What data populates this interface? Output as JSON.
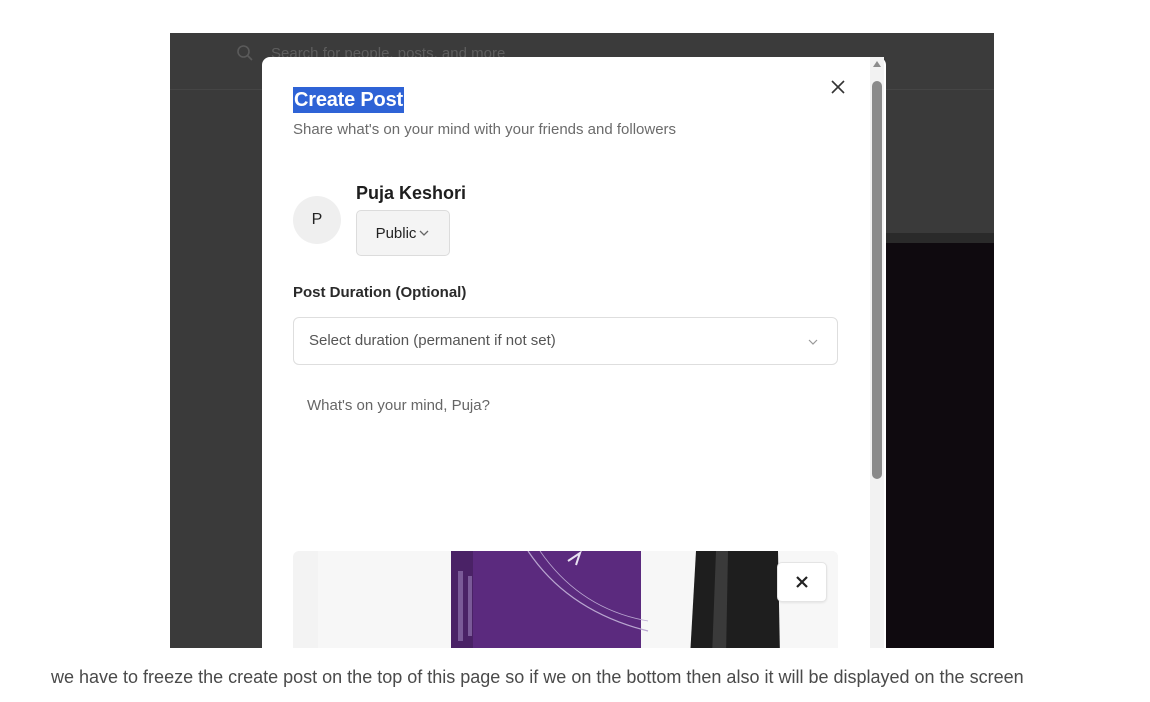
{
  "background": {
    "search_placeholder": "Search for people, posts, and more"
  },
  "modal": {
    "title": "Create Post",
    "subtitle": "Share what's on your mind with your friends and followers",
    "user": {
      "avatar_letter": "P",
      "name": "Puja Keshori",
      "privacy": "Public"
    },
    "duration": {
      "label": "Post Duration (Optional)",
      "placeholder": "Select duration (permanent if not set)"
    },
    "post_placeholder": "What's on your mind, Puja?",
    "icons": {
      "close": "close-icon",
      "remove_image": "close-icon",
      "privacy_dropdown": "chevron-down-icon",
      "duration_dropdown": "chevron-down-icon"
    }
  },
  "caption": "we have to freeze the create post on the top of this page so if we on the bottom then also it will be displayed on the screen",
  "colors": {
    "title_highlight": "#2e63d6",
    "overlay": "#3a3a3a",
    "scroll_thumb": "#8a8a8a"
  }
}
